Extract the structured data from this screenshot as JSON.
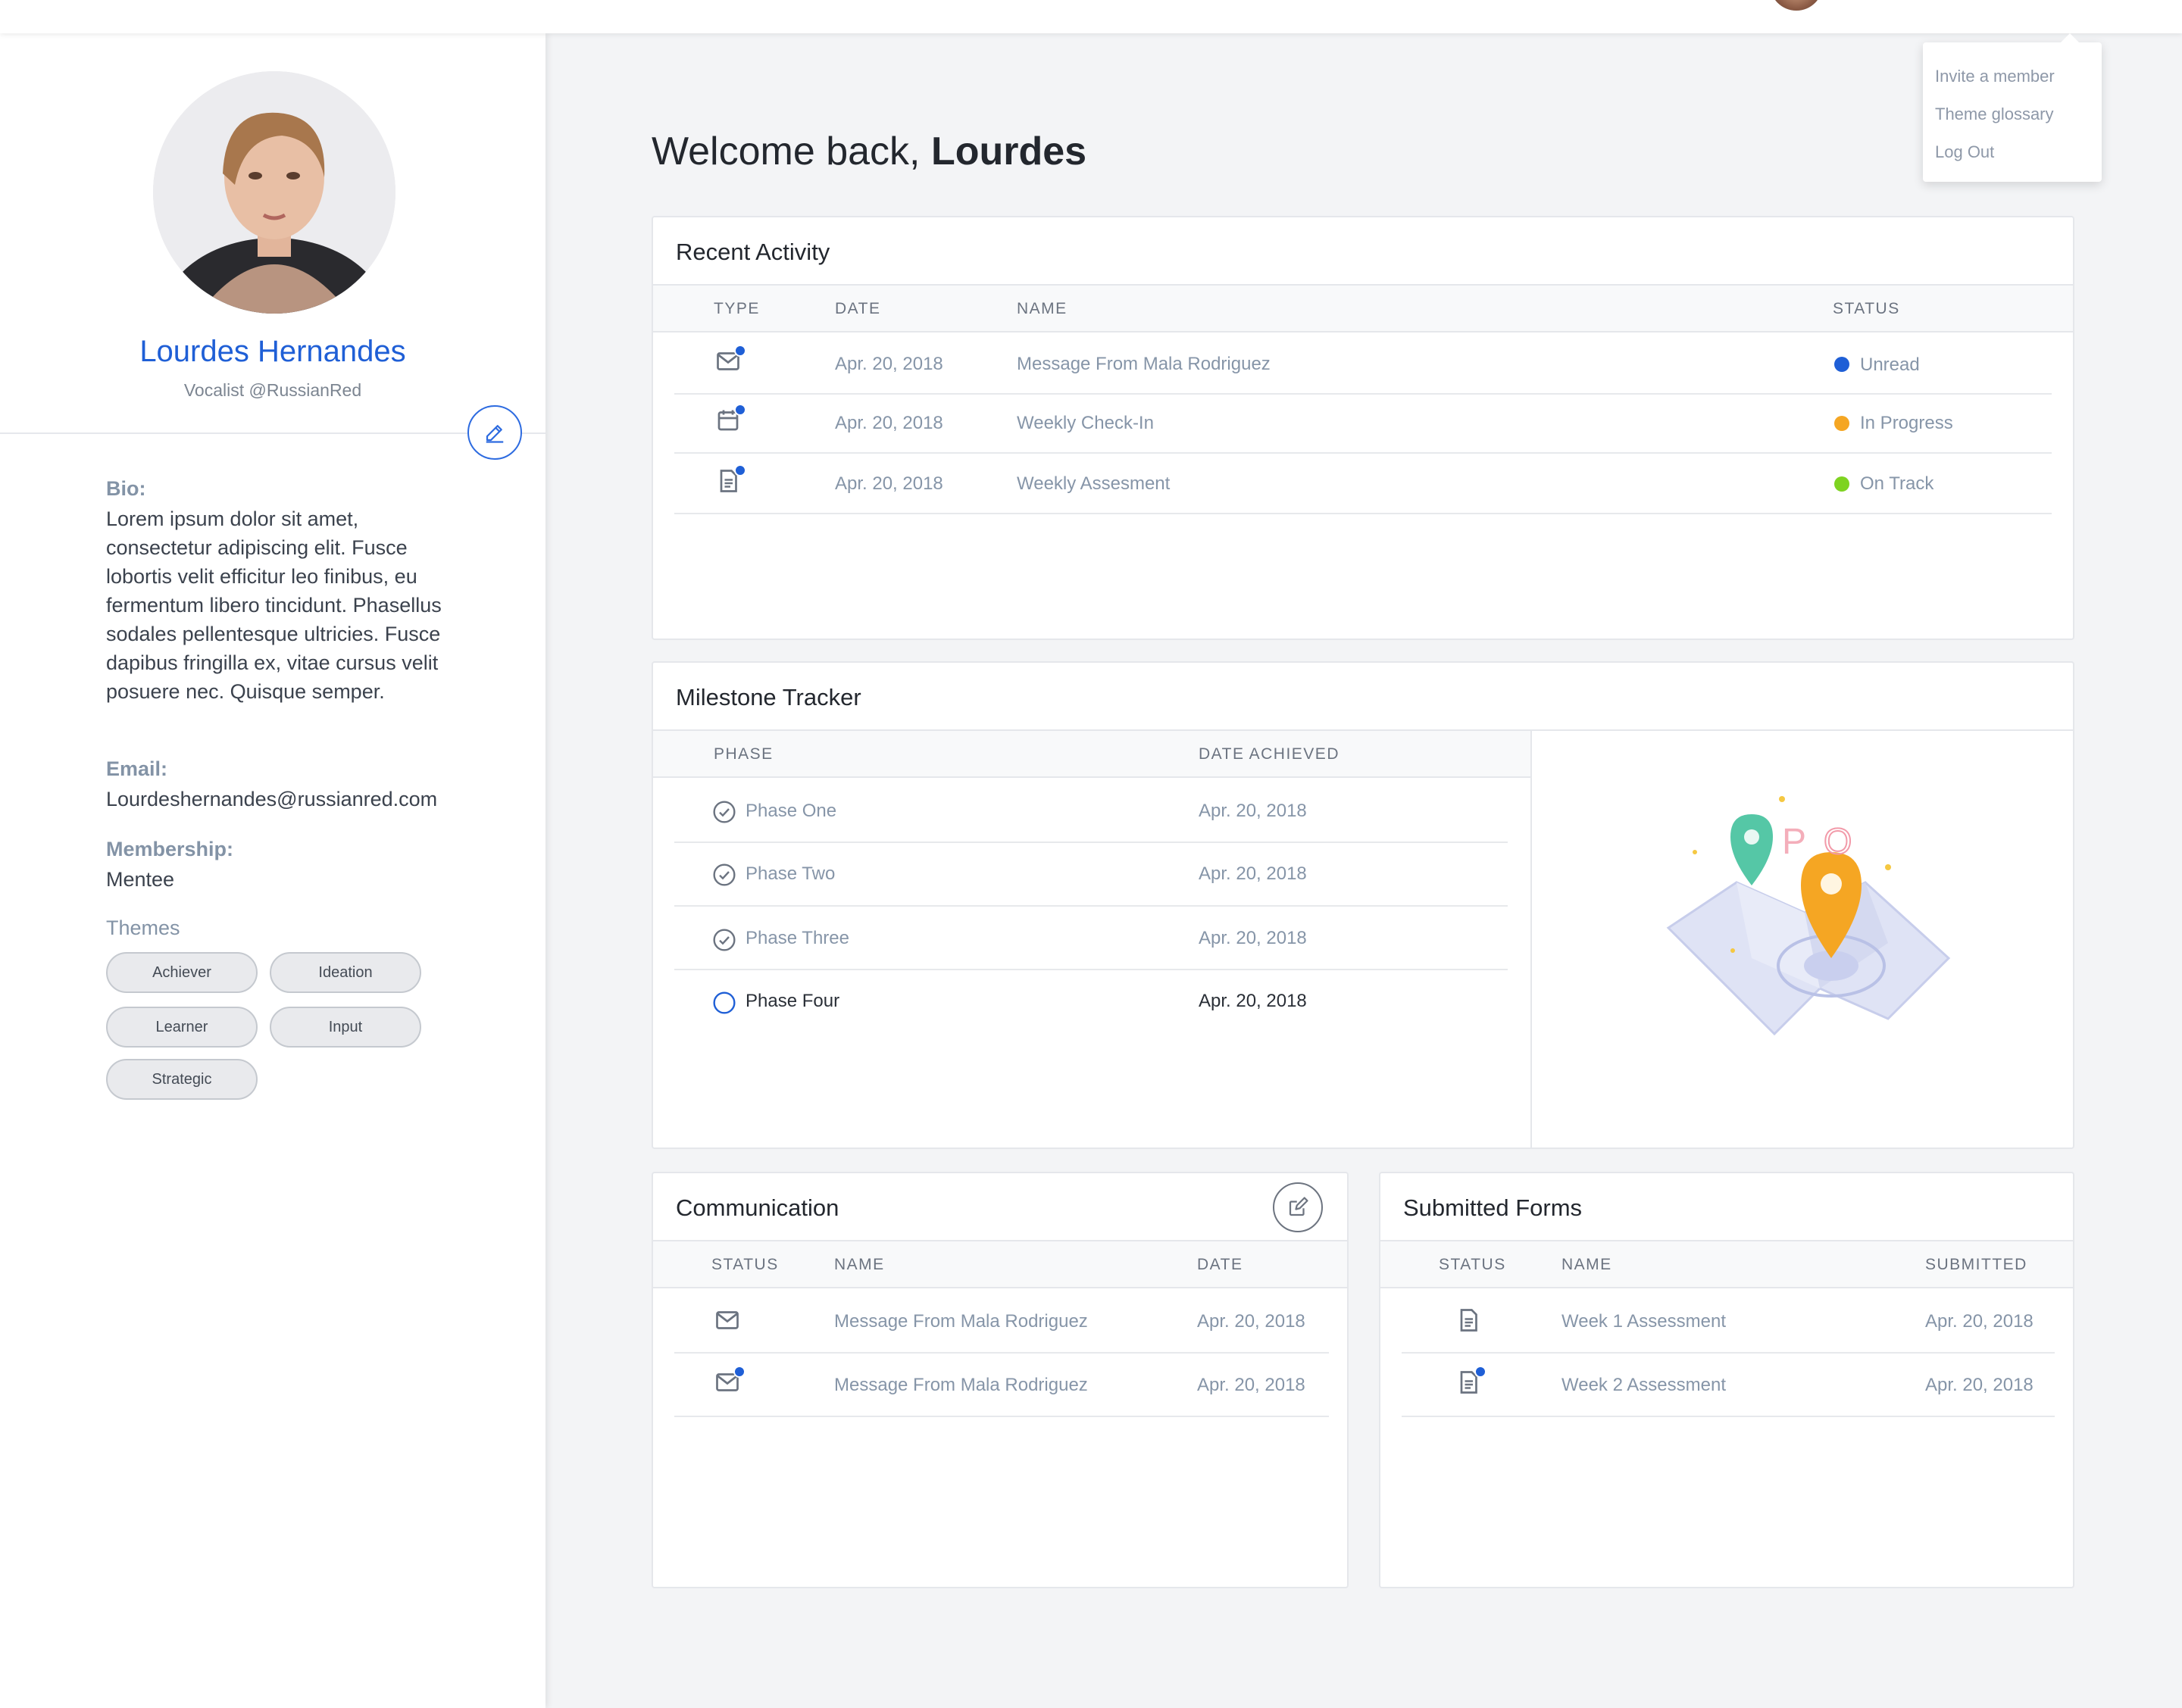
{
  "user_menu": {
    "items": [
      "Invite a member",
      "Theme glossary",
      "Log Out"
    ]
  },
  "profile": {
    "name": "Lourdes Hernandes",
    "handle": "Vocalist @RussianRed",
    "bio_label": "Bio:",
    "bio": "Lorem ipsum dolor sit amet, consectetur adipiscing elit. Fusce lobortis velit efficitur leo finibus, eu fermentum libero tincidunt. Phasellus sodales pellentesque ultricies. Fusce dapibus fringilla ex, vitae cursus velit posuere nec. Quisque semper.",
    "email_label": "Email:",
    "email": "Lourdeshernandes@russianred.com",
    "membership_label": "Membership:",
    "membership": "Mentee",
    "themes_label": "Themes",
    "themes": [
      "Achiever",
      "Ideation",
      "Learner",
      "Input",
      "Strategic"
    ]
  },
  "welcome": {
    "greeting": "Welcome back,",
    "name": "Lourdes"
  },
  "recent_activity": {
    "title": "Recent Activity",
    "columns": [
      "TYPE",
      "DATE",
      "NAME",
      "STATUS"
    ],
    "rows": [
      {
        "type": "mail-icon",
        "date": "Apr. 20, 2018",
        "name": "Message From Mala Rodriguez",
        "status": "Unread",
        "status_color": "#1f5fd6"
      },
      {
        "type": "calendar-icon",
        "date": "Apr. 20, 2018",
        "name": "Weekly Check-In",
        "status": "In Progress",
        "status_color": "#f5a623"
      },
      {
        "type": "document-icon",
        "date": "Apr. 20, 2018",
        "name": "Weekly Assesment",
        "status": "On Track",
        "status_color": "#7ed321"
      }
    ]
  },
  "milestone_tracker": {
    "title": "Milestone Tracker",
    "columns": [
      "PHASE",
      "DATE ACHIEVED"
    ],
    "rows": [
      {
        "phase": "Phase One",
        "date": "Apr. 20, 2018",
        "done": true
      },
      {
        "phase": "Phase Two",
        "date": "Apr. 20, 2018",
        "done": true
      },
      {
        "phase": "Phase Three",
        "date": "Apr. 20, 2018",
        "done": true
      },
      {
        "phase": "Phase Four",
        "date": "Apr. 20, 2018",
        "done": false
      }
    ]
  },
  "communication": {
    "title": "Communication",
    "columns": [
      "STATUS",
      "NAME",
      "DATE"
    ],
    "rows": [
      {
        "name": "Message From Mala Rodriguez",
        "date": "Apr. 20, 2018",
        "unread": false
      },
      {
        "name": "Message From Mala Rodriguez",
        "date": "Apr. 20, 2018",
        "unread": true
      }
    ]
  },
  "submitted_forms": {
    "title": "Submitted Forms",
    "columns": [
      "STATUS",
      "NAME",
      "SUBMITTED"
    ],
    "rows": [
      {
        "name": "Week 1 Assessment",
        "date": "Apr. 20, 2018",
        "unread": false
      },
      {
        "name": "Week 2 Assessment",
        "date": "Apr. 20, 2018",
        "unread": true
      }
    ]
  },
  "colors": {
    "accent": "#1f5fd6",
    "in_progress": "#f5a623",
    "on_track": "#7ed321"
  }
}
